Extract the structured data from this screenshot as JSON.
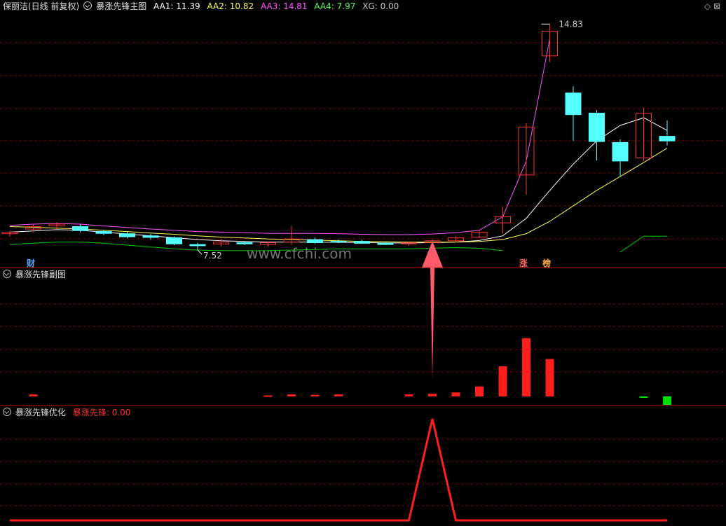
{
  "header_main": {
    "stock": "保丽洁(日线 前复权)",
    "indicator": "暴涨先锋主图",
    "aa1": {
      "label": "AA1:",
      "value": "11.39"
    },
    "aa2": {
      "label": "AA2:",
      "value": "10.82"
    },
    "aa3": {
      "label": "AA3:",
      "value": "14.81"
    },
    "aa4": {
      "label": "AA4:",
      "value": "7.97"
    },
    "xg": {
      "label": "XG:",
      "value": "0.00"
    }
  },
  "header_sub": {
    "indicator": "暴涨先锋副图"
  },
  "header_opt": {
    "indicator": "暴涨先锋优化",
    "series_label": "暴涨先锋:",
    "series_value": "0.00"
  },
  "labels": {
    "high_price": "14.83",
    "low_price": "7.52",
    "cai": "财",
    "zhang": "涨",
    "bang": "榜",
    "watermark": "www.cfchi.com"
  },
  "colors": {
    "up": "#ff3232",
    "down": "#54ffff",
    "aa1": "#ffffff",
    "aa2": "#ffff54",
    "aa3": "#ff54ff",
    "aa4": "#00c800",
    "grid": "#8b0000",
    "sep": "#c80000"
  },
  "chart_data": [
    {
      "type": "candlestick",
      "title": "暴涨先锋主图",
      "ylim": [
        7.0,
        15.2
      ],
      "candles": [
        {
          "o": 8.05,
          "h": 8.15,
          "l": 7.95,
          "c": 8.1
        },
        {
          "o": 8.2,
          "h": 8.35,
          "l": 8.1,
          "c": 8.28
        },
        {
          "o": 8.3,
          "h": 8.42,
          "l": 8.2,
          "c": 8.36
        },
        {
          "o": 8.28,
          "h": 8.35,
          "l": 8.1,
          "c": 8.15
        },
        {
          "o": 8.12,
          "h": 8.18,
          "l": 8.0,
          "c": 8.06
        },
        {
          "o": 8.05,
          "h": 8.12,
          "l": 7.9,
          "c": 7.95
        },
        {
          "o": 7.98,
          "h": 8.05,
          "l": 7.85,
          "c": 7.93
        },
        {
          "o": 7.92,
          "h": 7.96,
          "l": 7.68,
          "c": 7.72
        },
        {
          "o": 7.7,
          "h": 7.76,
          "l": 7.52,
          "c": 7.66
        },
        {
          "o": 7.72,
          "h": 7.88,
          "l": 7.64,
          "c": 7.78
        },
        {
          "o": 7.76,
          "h": 7.8,
          "l": 7.68,
          "c": 7.72
        },
        {
          "o": 7.7,
          "h": 7.8,
          "l": 7.62,
          "c": 7.76
        },
        {
          "o": 7.78,
          "h": 8.3,
          "l": 7.7,
          "c": 7.88
        },
        {
          "o": 7.86,
          "h": 7.92,
          "l": 7.72,
          "c": 7.76
        },
        {
          "o": 7.8,
          "h": 7.86,
          "l": 7.74,
          "c": 7.78
        },
        {
          "o": 7.8,
          "h": 7.86,
          "l": 7.72,
          "c": 7.74
        },
        {
          "o": 7.74,
          "h": 7.8,
          "l": 7.68,
          "c": 7.7
        },
        {
          "o": 7.72,
          "h": 7.78,
          "l": 7.66,
          "c": 7.76
        },
        {
          "o": 7.76,
          "h": 7.86,
          "l": 7.72,
          "c": 7.82
        },
        {
          "o": 7.82,
          "h": 7.96,
          "l": 7.78,
          "c": 7.92
        },
        {
          "o": 7.94,
          "h": 8.18,
          "l": 7.9,
          "c": 8.1
        },
        {
          "o": 8.4,
          "h": 8.92,
          "l": 8.05,
          "c": 8.6
        },
        {
          "o": 9.95,
          "h": 11.62,
          "l": 9.31,
          "c": 11.5
        },
        {
          "o": 13.8,
          "h": 14.83,
          "l": 13.6,
          "c": 14.6
        },
        {
          "o": 12.6,
          "h": 12.82,
          "l": 11.05,
          "c": 11.9
        },
        {
          "o": 11.95,
          "h": 12.05,
          "l": 10.42,
          "c": 11.03
        },
        {
          "o": 11.0,
          "h": 11.1,
          "l": 9.9,
          "c": 10.4
        },
        {
          "o": 10.5,
          "h": 12.13,
          "l": 10.4,
          "c": 11.94
        },
        {
          "o": 11.2,
          "h": 11.72,
          "l": 10.9,
          "c": 11.05
        }
      ],
      "series": [
        {
          "name": "AA1",
          "color": "#ffffff",
          "values": [
            8.1,
            8.14,
            8.18,
            8.16,
            8.1,
            8.04,
            7.98,
            7.92,
            7.86,
            7.82,
            7.8,
            7.78,
            7.78,
            7.78,
            7.77,
            7.76,
            7.75,
            7.75,
            7.76,
            7.78,
            7.83,
            7.98,
            8.55,
            9.45,
            10.3,
            11.05,
            11.55,
            11.8,
            11.39
          ]
        },
        {
          "name": "AA2",
          "color": "#ffff54",
          "values": [
            8.28,
            8.26,
            8.23,
            8.2,
            8.16,
            8.12,
            8.07,
            8.03,
            7.98,
            7.94,
            7.91,
            7.88,
            7.86,
            7.84,
            7.82,
            7.8,
            7.79,
            7.78,
            7.78,
            7.78,
            7.8,
            7.86,
            8.05,
            8.45,
            8.95,
            9.45,
            9.9,
            10.35,
            10.82
          ]
        },
        {
          "name": "AA3",
          "color": "#ff54ff",
          "values": [
            8.32,
            8.36,
            8.38,
            8.36,
            8.3,
            8.25,
            8.2,
            8.16,
            8.12,
            8.1,
            8.08,
            8.06,
            8.06,
            8.06,
            8.05,
            8.03,
            8.02,
            8.02,
            8.04,
            8.08,
            8.16,
            8.6,
            10.4,
            14.35
          ]
        },
        {
          "name": "AA4",
          "color": "#00c800",
          "values": [
            7.7,
            7.74,
            7.78,
            7.78,
            7.74,
            7.68,
            7.62,
            7.56,
            7.52,
            7.5,
            7.5,
            7.5,
            7.52,
            7.54,
            7.56,
            7.56,
            7.56,
            7.56,
            7.58,
            7.6,
            7.58,
            7.5,
            null,
            null,
            null,
            null,
            7.45,
            7.97,
            7.97
          ]
        }
      ]
    },
    {
      "type": "bar",
      "title": "暴涨先锋副图",
      "ylim": [
        -1.5,
        9.0
      ],
      "values": [
        null,
        0.3,
        null,
        null,
        null,
        null,
        null,
        null,
        null,
        null,
        null,
        0.15,
        0.3,
        0.25,
        0.3,
        null,
        null,
        0.3,
        0.4,
        0.6,
        1.5,
        4.5,
        8.7,
        5.6,
        null,
        null,
        null,
        -0.1,
        -1.0
      ]
    },
    {
      "type": "line",
      "title": "暴涨先锋优化",
      "ylim": [
        0,
        1.05
      ],
      "values": [
        0,
        0,
        0,
        0,
        0,
        0,
        0,
        0,
        0,
        0,
        0,
        0,
        0,
        0,
        0,
        0,
        0,
        0,
        1,
        0,
        0,
        0,
        0,
        0,
        0,
        0,
        0,
        0,
        0
      ]
    }
  ]
}
